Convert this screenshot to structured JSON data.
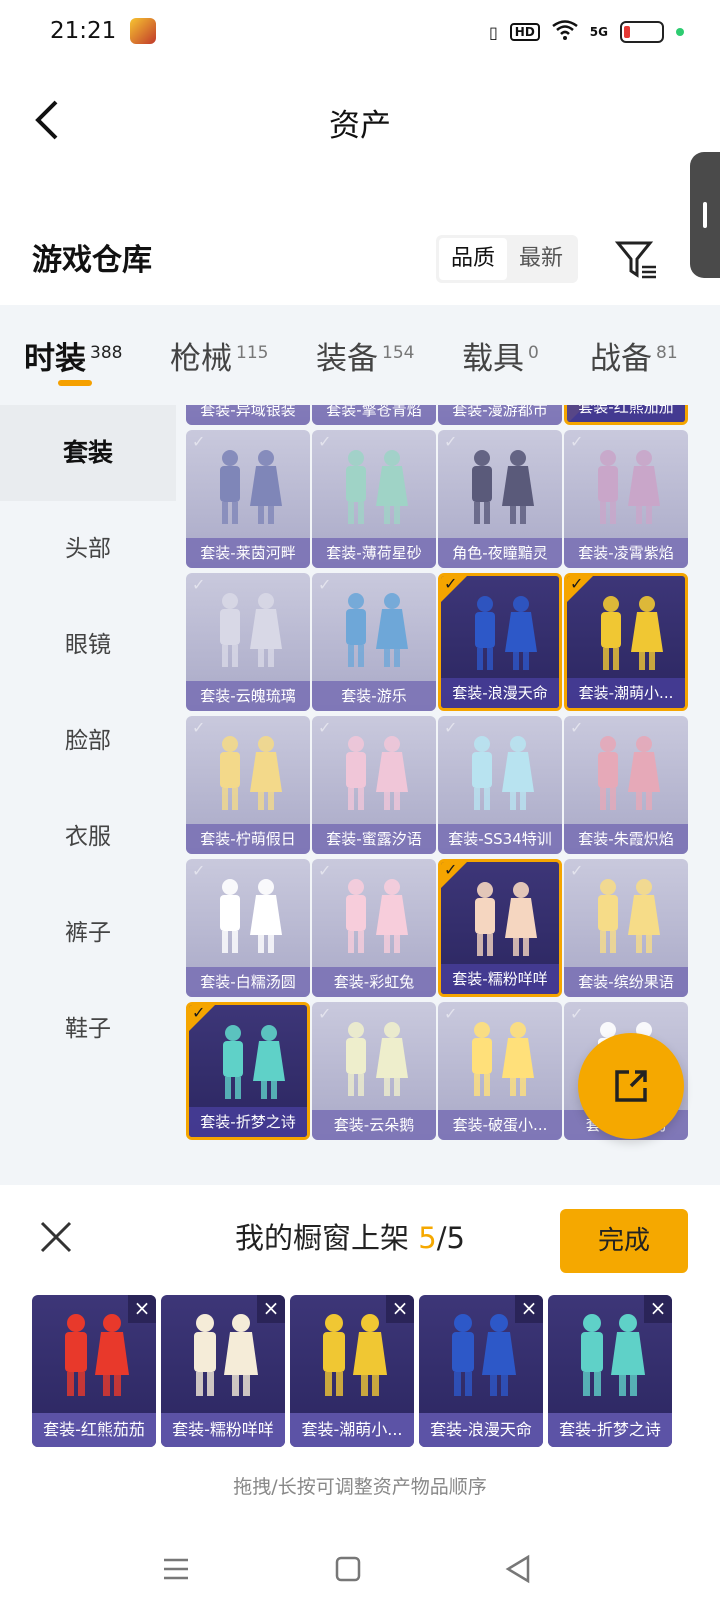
{
  "status": {
    "time": "21:21",
    "network": "5G",
    "hd": "HD"
  },
  "header": {
    "title": "资产"
  },
  "warehouse": {
    "title": "游戏仓库",
    "sort_options": [
      "品质",
      "最新"
    ],
    "active_sort": "品质"
  },
  "tabs": [
    {
      "label": "时装",
      "count": "388",
      "active": true
    },
    {
      "label": "枪械",
      "count": "115"
    },
    {
      "label": "装备",
      "count": "154"
    },
    {
      "label": "载具",
      "count": "0"
    },
    {
      "label": "战备",
      "count": "81"
    }
  ],
  "sidebar": [
    "套装",
    "头部",
    "眼镜",
    "脸部",
    "衣服",
    "裤子",
    "鞋子"
  ],
  "grid": {
    "top_row": [
      "套装-异域银装",
      "套装-擎苍青焰",
      "套装-漫游都市",
      "套装-红熊茄茄"
    ],
    "items": [
      "套装-莱茵河畔",
      "套装-薄荷星砂",
      "角色-夜瞳黯灵",
      "套装-凌霄紫焰",
      "套装-云魄琉璃",
      "套装-游乐",
      "套装-浪漫天命",
      "套装-潮萌小...",
      "套装-柠萌假日",
      "套装-蜜露汐语",
      "套装-SS34特训",
      "套装-朱霞炽焰",
      "套装-白糯汤圆",
      "套装-彩虹兔",
      "套装-糯粉咩咩",
      "套装-缤纷果语",
      "套装-折梦之诗",
      "套装-云朵鹅",
      "套装-破蛋小...",
      "套装-雪绒豹"
    ]
  },
  "panel": {
    "title_prefix": "我的橱窗上架",
    "count_current": "5",
    "count_total": "/5",
    "done_label": "完成",
    "slots": [
      "套装-红熊茄茄",
      "套装-糯粉咩咩",
      "套装-潮萌小...",
      "套装-浪漫天命",
      "套装-折梦之诗"
    ],
    "hint": "拖拽/长按可调整资产物品顺序"
  },
  "colors": {
    "accent": "#f5a800",
    "selected_card": "#2b2660"
  }
}
